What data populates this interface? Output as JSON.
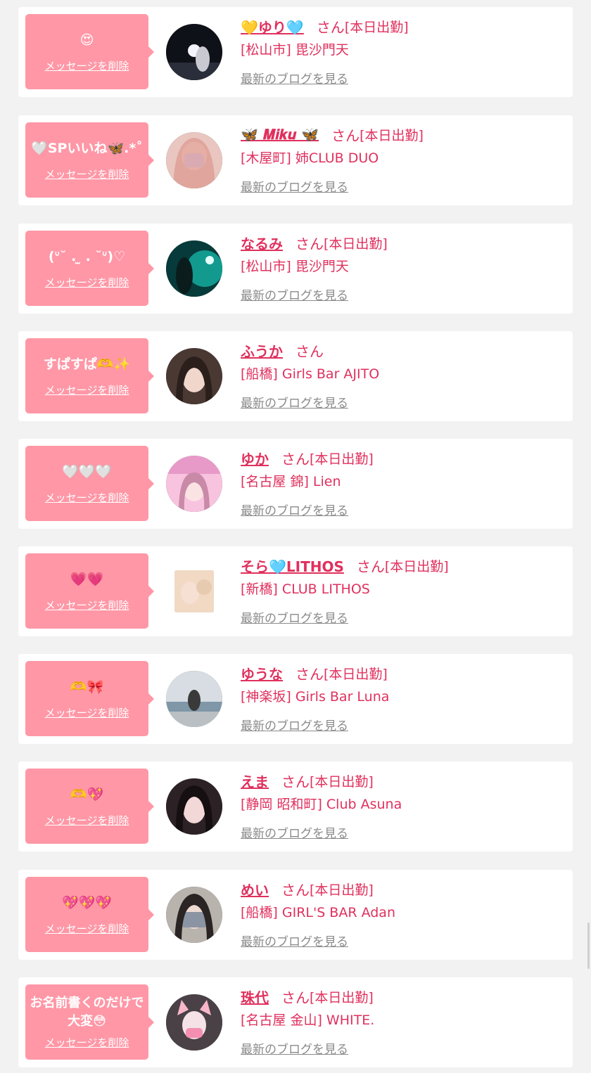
{
  "items": [
    {
      "message": "😍",
      "delete_label": "メッセージを削除",
      "name": "💛ゆり🩵",
      "san": "さん",
      "shift": "[本日出勤]",
      "shop": "[松山市] 毘沙門天",
      "blog_label": "最新のブログを見る",
      "avatar_theme": "night"
    },
    {
      "message": "🤍SPいいね🦋.*˚",
      "delete_label": "メッセージを削除",
      "name": "🦋 𝑴𝒊𝒌𝒖 🦋",
      "san": "さん",
      "shift": "[本日出勤]",
      "shop": "[木屋町] 姉CLUB DUO",
      "blog_label": "最新のブログを見る",
      "avatar_theme": "pink"
    },
    {
      "message": "(ᐡ˘ . ̫ . ˘ᐡ)♡",
      "delete_label": "メッセージを削除",
      "name": "なるみ",
      "san": "さん",
      "shift": "[本日出勤]",
      "shop": "[松山市] 毘沙門天",
      "blog_label": "最新のブログを見る",
      "avatar_theme": "aqua"
    },
    {
      "message": "すぱすぱ🫶✨",
      "delete_label": "メッセージを削除",
      "name": "ふうか",
      "san": "さん",
      "shift": "",
      "shop": "[船橋] Girls Bar AJITO",
      "blog_label": "最新のブログを見る",
      "avatar_theme": "dark"
    },
    {
      "message": "🤍🤍🤍",
      "delete_label": "メッセージを削除",
      "name": "ゆか",
      "san": "さん",
      "shift": "[本日出勤]",
      "shop": "[名古屋 錦] Lien",
      "blog_label": "最新のブログを見る",
      "avatar_theme": "lien"
    },
    {
      "message": "💗💗",
      "delete_label": "メッセージを削除",
      "name": "そら🩵LITHOS",
      "san": "さん",
      "shift": "[本日出勤]",
      "shop": "[新橋] CLUB LITHOS",
      "blog_label": "最新のブログを見る",
      "avatar_theme": "beige"
    },
    {
      "message": "🫶🎀",
      "delete_label": "メッセージを削除",
      "name": "ゆうな",
      "san": "さん",
      "shift": "[本日出勤]",
      "shop": "[神楽坂] Girls Bar Luna",
      "blog_label": "最新のブログを見る",
      "avatar_theme": "sea"
    },
    {
      "message": "🫶💖",
      "delete_label": "メッセージを削除",
      "name": "えま",
      "san": "さん",
      "shift": "[本日出勤]",
      "shop": "[静岡 昭和町] Club Asuna",
      "blog_label": "最新のブログを見る",
      "avatar_theme": "dark"
    },
    {
      "message": "💖💖💖",
      "delete_label": "メッセージを削除",
      "name": "めい",
      "san": "さん",
      "shift": "[本日出勤]",
      "shop": "[船橋] GIRL'S BAR Adan",
      "blog_label": "最新のブログを見る",
      "avatar_theme": "gray"
    },
    {
      "message": "お名前書くのだけで大変😳",
      "delete_label": "メッセージを削除",
      "name": "珠代",
      "san": "さん",
      "shift": "[本日出勤]",
      "shop": "[名古屋 金山] WHITE.",
      "blog_label": "最新のブログを見る",
      "avatar_theme": "cat"
    }
  ],
  "colors": {
    "bubble": "#ff97a6",
    "accent": "#e0305d",
    "link_gray": "#8a8a8a",
    "background": "#f2f2f2"
  }
}
